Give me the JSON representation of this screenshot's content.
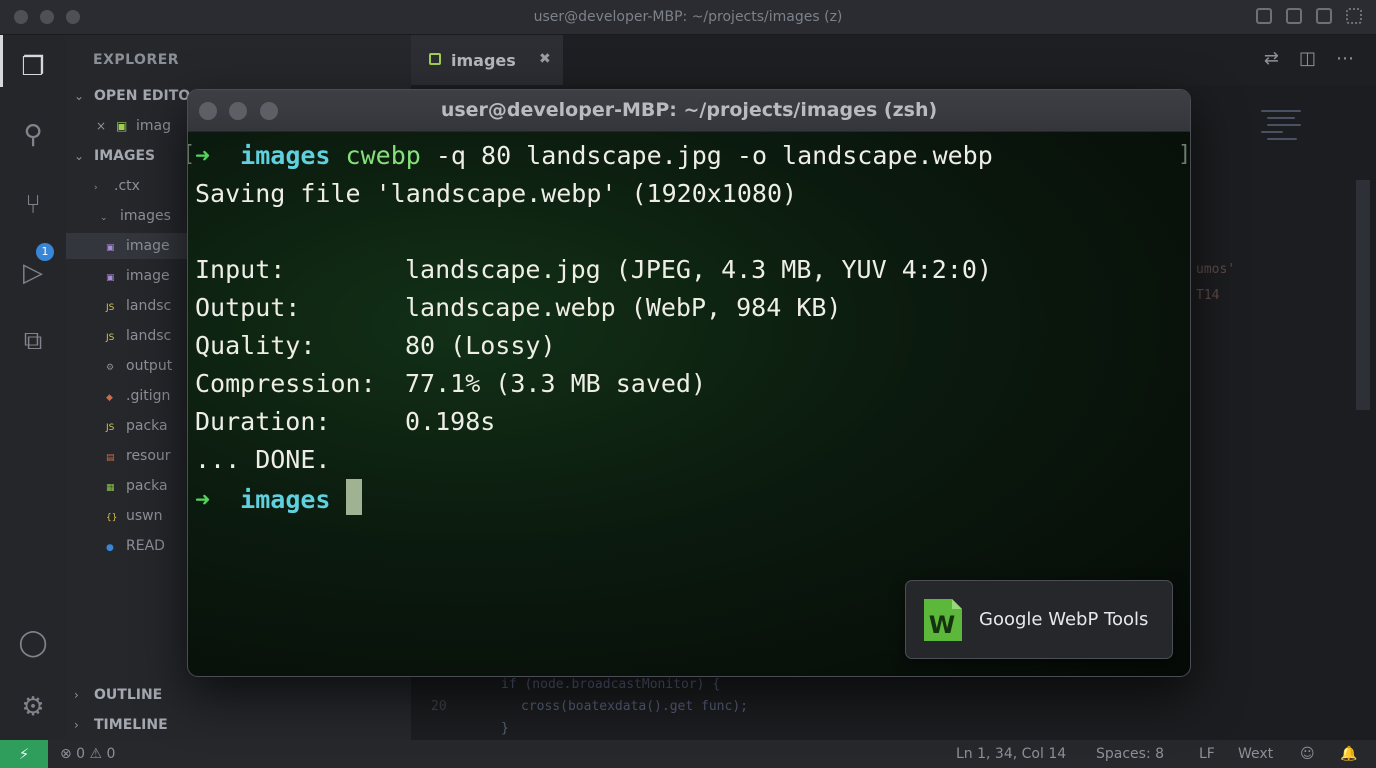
{
  "vscode": {
    "window_title": "user@developer-MBP: ~/projects/images (z)",
    "explorer_header": "EXPLORER",
    "open_editors_header": "OPEN EDITO",
    "open_editor_item": "imag",
    "images_header": "IMAGES",
    "tree": [
      {
        "label": ".ctx",
        "icon": "chevron-right-icon",
        "color": "#8d9199"
      },
      {
        "label": "images",
        "icon": "chevron-down-icon",
        "color": "#8d9199"
      },
      {
        "label": "image",
        "icon": "image-file-icon",
        "color": "#a98bd6"
      },
      {
        "label": "image",
        "icon": "image-file-icon",
        "color": "#a98bd6"
      },
      {
        "label": "landsc",
        "icon": "js-file-icon",
        "color": "#d6c552"
      },
      {
        "label": "landsc",
        "icon": "js-file-icon",
        "color": "#d6c552"
      },
      {
        "label": "output",
        "icon": "gear-file-icon",
        "color": "#8d9199"
      },
      {
        "label": ".gitign",
        "icon": "git-file-icon",
        "color": "#d06a44"
      },
      {
        "label": "packa",
        "icon": "js-file-icon",
        "color": "#d6c552"
      },
      {
        "label": "resour",
        "icon": "xml-file-icon",
        "color": "#d06a44"
      },
      {
        "label": "packa",
        "icon": "npm-file-icon",
        "color": "#8bc34a"
      },
      {
        "label": "uswn",
        "icon": "json-file-icon",
        "color": "#d6c552"
      },
      {
        "label": "READ",
        "icon": "info-file-icon",
        "color": "#3a86d6"
      }
    ],
    "outline_header": "OUTLINE",
    "timeline_header": "TIMELINE",
    "tab_label": "images",
    "tab_close": "✖",
    "scm_badge": "1",
    "editor_line_numbers": [
      "",
      "20"
    ],
    "editor_code": [
      "if (node.broadcastMonitor) {",
      "cross(boatexdata().get func);",
      "}"
    ],
    "side_code": [
      "umos'",
      "T14"
    ]
  },
  "statusbar": {
    "remote_icon": "⚡",
    "problems": "⊗ 0 ⚠ 0",
    "cursor_pos": "Ln 1, 34, Col 14",
    "spaces": "Spaces: 8",
    "eol": "LF",
    "language": "Wext"
  },
  "terminal": {
    "title": "user@developer-MBP: ~/projects/images (zsh)",
    "prompt_arrow": "➜",
    "prompt_dir": "images",
    "command_name": "cwebp",
    "command_args": "-q 80 landscape.jpg -o landscape.webp",
    "saving_line": "Saving file 'landscape.webp' (1920x1080)",
    "stats": [
      {
        "label": "Input:",
        "value": "landscape.jpg (JPEG, 4.3 MB, YUV 4:2:0)"
      },
      {
        "label": "Output:",
        "value": "landscape.webp (WebP, 984 KB)"
      },
      {
        "label": "Quality:",
        "value": "80 (Lossy)"
      },
      {
        "label": "Compression:",
        "value": "77.1% (3.3 MB saved)"
      },
      {
        "label": "Duration:",
        "value": "0.198s"
      }
    ],
    "done_line": "... DONE."
  },
  "notification": {
    "icon_letter": "W",
    "text": "Google WebP Tools",
    "icon_color": "#5cb83a"
  }
}
